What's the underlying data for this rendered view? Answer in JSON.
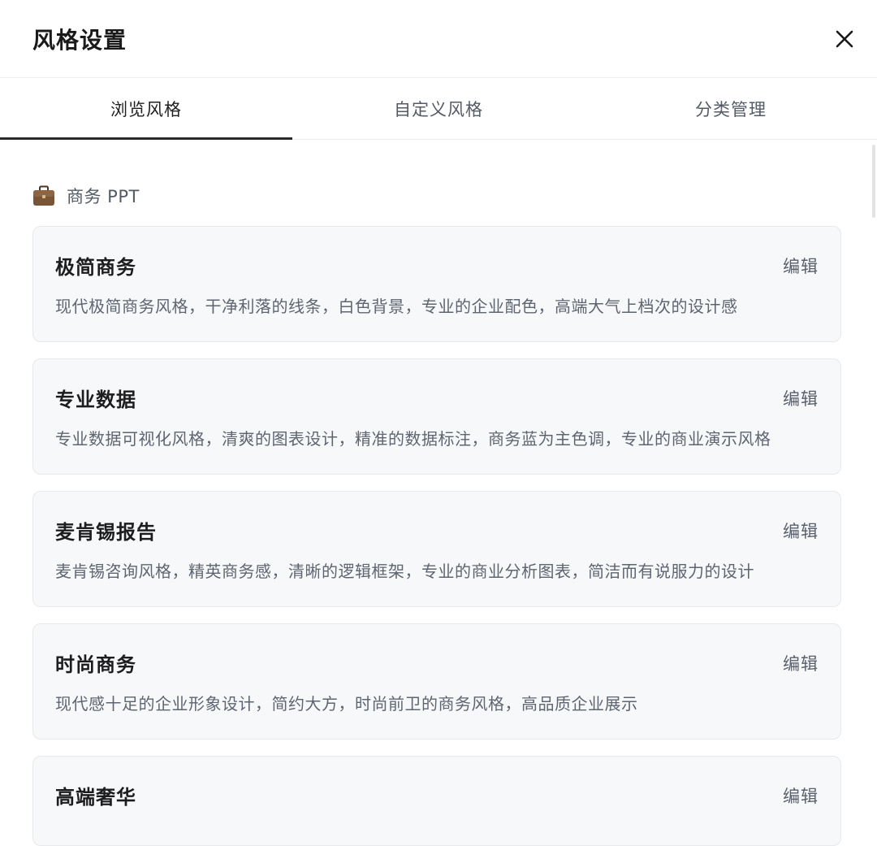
{
  "dialog": {
    "title": "风格设置",
    "close_icon": "close-icon"
  },
  "tabs": [
    {
      "label": "浏览风格",
      "active": true
    },
    {
      "label": "自定义风格",
      "active": false
    },
    {
      "label": "分类管理",
      "active": false
    }
  ],
  "section": {
    "icon": "briefcase-icon",
    "title": "商务 PPT"
  },
  "styles": [
    {
      "name": "极简商务",
      "edit_label": "编辑",
      "description": "现代极简商务风格，干净利落的线条，白色背景，专业的企业配色，高端大气上档次的设计感"
    },
    {
      "name": "专业数据",
      "edit_label": "编辑",
      "description": "专业数据可视化风格，清爽的图表设计，精准的数据标注，商务蓝为主色调，专业的商业演示风格"
    },
    {
      "name": "麦肯锡报告",
      "edit_label": "编辑",
      "description": "麦肯锡咨询风格，精英商务感，清晰的逻辑框架，专业的商业分析图表，简洁而有说服力的设计"
    },
    {
      "name": "时尚商务",
      "edit_label": "编辑",
      "description": "现代感十足的企业形象设计，简约大方，时尚前卫的商务风格，高品质企业展示"
    },
    {
      "name": "高端奢华",
      "edit_label": "编辑",
      "description": ""
    }
  ],
  "colors": {
    "accent": "#2b2b2b",
    "card_bg": "#f7f8fa",
    "text_muted": "#5f6570"
  }
}
